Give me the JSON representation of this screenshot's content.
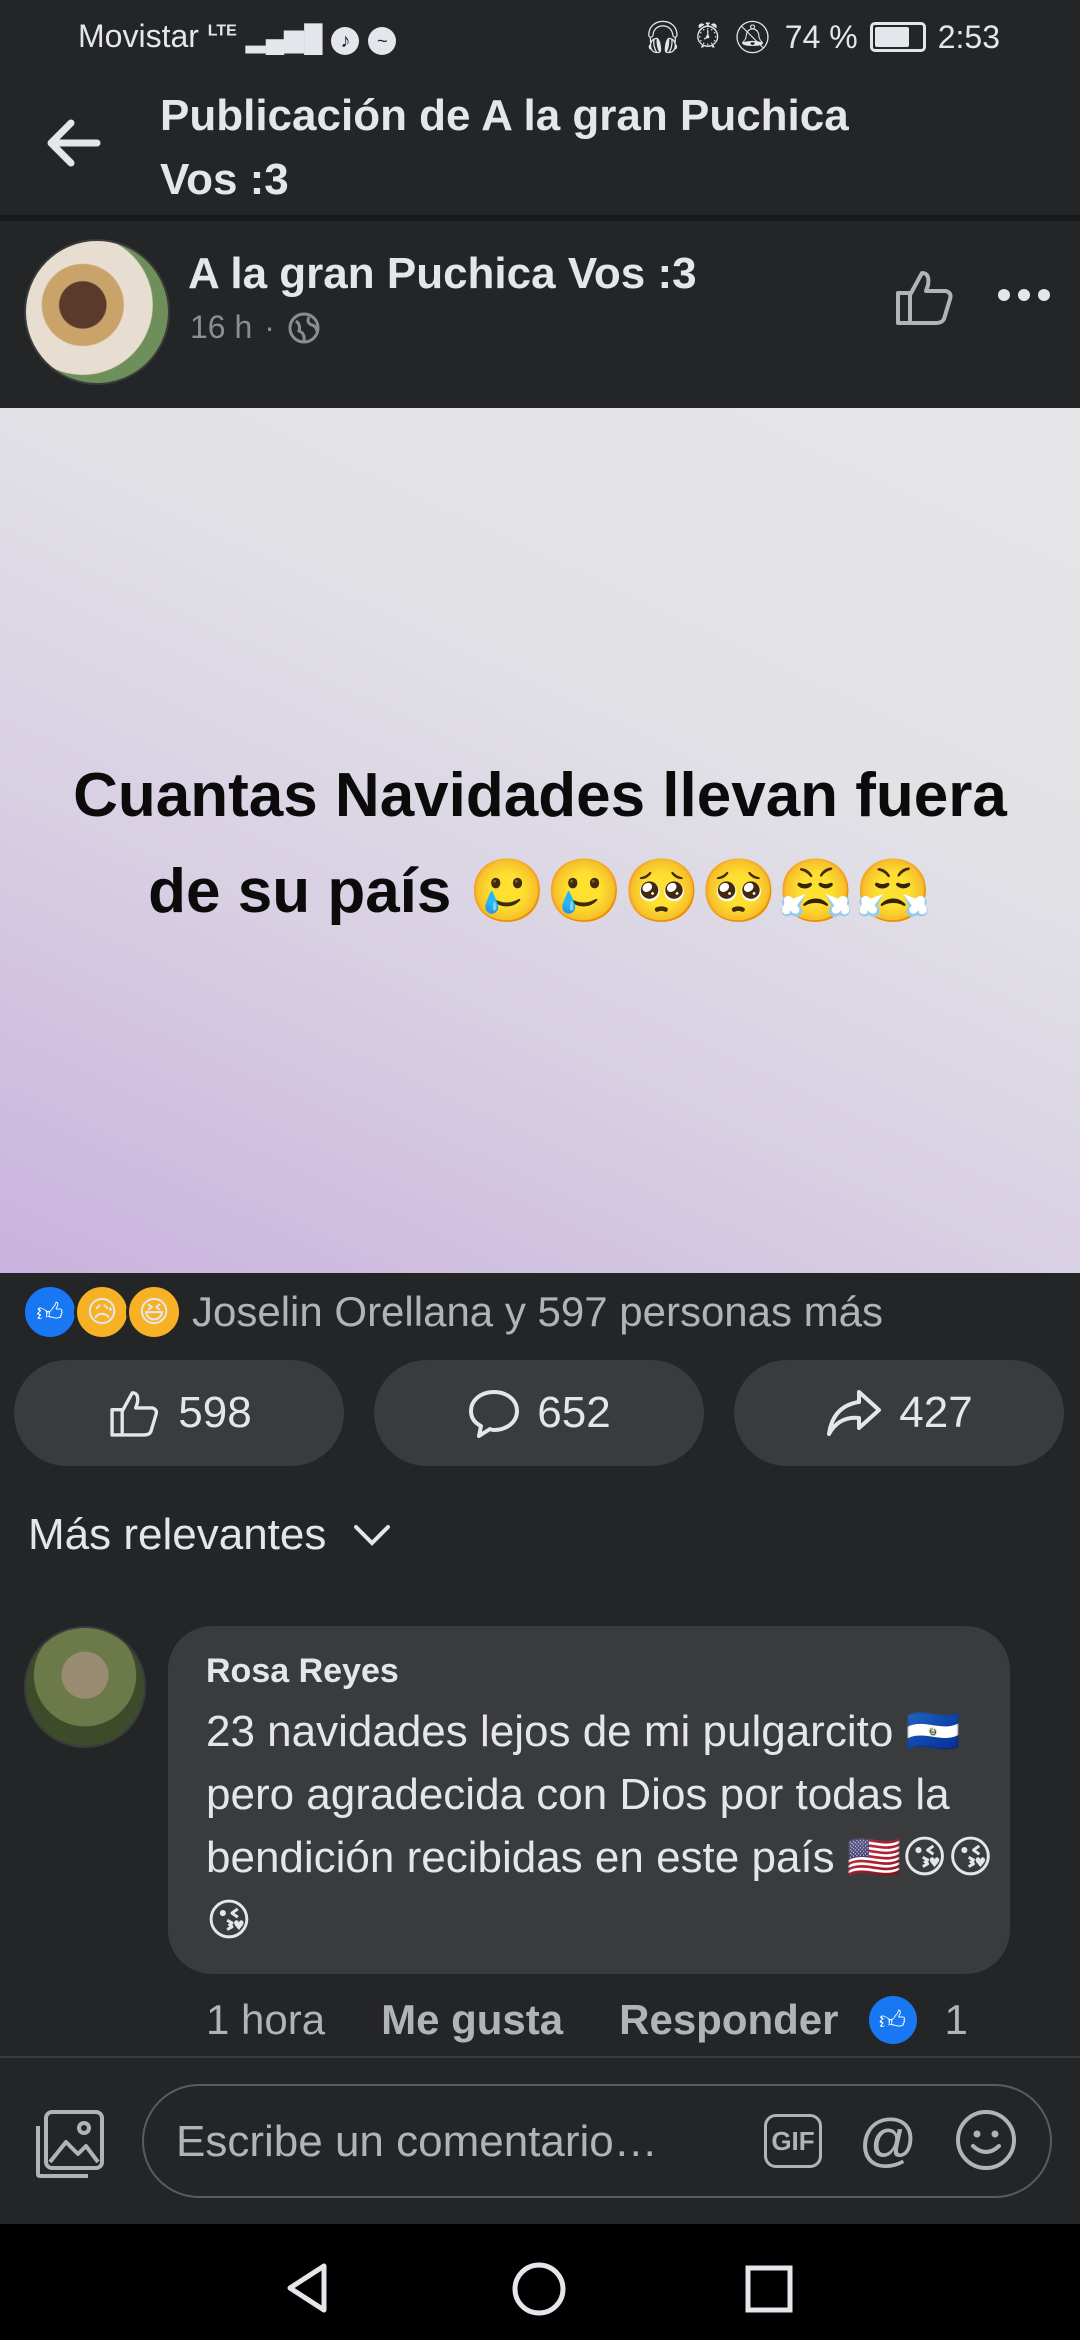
{
  "status_bar": {
    "carrier": "Movistar",
    "network": "LTE",
    "battery": "74 %",
    "time": "2:53"
  },
  "header": {
    "title_line1": "Publicación de A la gran Puchica",
    "title_line2": "Vos :3"
  },
  "post": {
    "page_name": "A la gran Puchica Vos :3",
    "time": "16 h",
    "separator": "·",
    "text_line1": "Cuantas Navidades llevan fuera",
    "text_line2": "de su país 🥲🥲🥺🥺😤😤",
    "reactions_text": "Joselin Orellana y 597 personas más",
    "like_count": "598",
    "comment_count": "652",
    "share_count": "427"
  },
  "sort": {
    "label": "Más relevantes"
  },
  "comment": {
    "author": "Rosa Reyes",
    "text": "23 navidades lejos de mi pulgarcito 🇸🇻pero agradecida con Dios por todas la bendición recibidas en este país 🇺🇸😘😘😘",
    "time": "1 hora",
    "like_label": "Me gusta",
    "reply_label": "Responder",
    "like_count": "1"
  },
  "composer": {
    "placeholder": "Escribe un comentario…",
    "gif_label": "GIF",
    "mention_label": "@"
  },
  "colors": {
    "background": "#242527",
    "pill": "#3a3b3c",
    "like_blue": "#1877f2",
    "text": "#e4e6eb",
    "muted": "#b0b3b8"
  }
}
